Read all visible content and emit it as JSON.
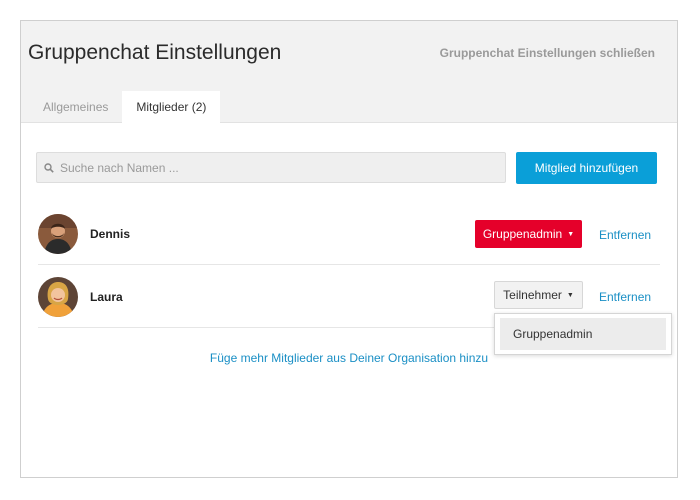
{
  "dialog": {
    "title": "Gruppenchat Einstellungen",
    "close_label": "Gruppenchat Einstellungen schließen"
  },
  "tabs": [
    {
      "label": "Allgemeines",
      "active": false
    },
    {
      "label": "Mitglieder (2)",
      "active": true
    }
  ],
  "search": {
    "placeholder": "Suche nach Namen ...",
    "value": "",
    "icon": "search-icon"
  },
  "add_member_label": "Mitglied hinzufügen",
  "members": [
    {
      "name": "Dennis",
      "role": "Gruppenadmin",
      "remove_label": "Entfernen",
      "role_color": "#e5002a"
    },
    {
      "name": "Laura",
      "role": "Teilnehmer",
      "remove_label": "Entfernen"
    }
  ],
  "role_dropdown": {
    "options": [
      "Gruppenadmin"
    ]
  },
  "add_from_org_label": "Füge mehr Mitglieder aus Deiner Organisation hinzu",
  "colors": {
    "accent": "#0a9fd8",
    "admin": "#e5002a",
    "link": "#1a8fc5"
  }
}
